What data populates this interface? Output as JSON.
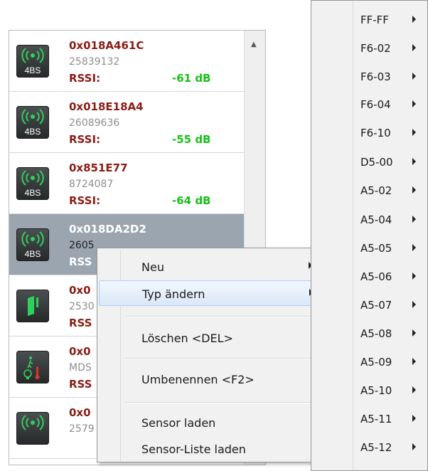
{
  "devices": [
    {
      "id": "0x018A461C",
      "number": "25839132",
      "rssi_label": "RSSI:",
      "rssi_value": "-61 dB",
      "icon": "radio-waves-icon",
      "icon_label": "4BS"
    },
    {
      "id": "0x018E18A4",
      "number": "26089636",
      "rssi_label": "RSSI:",
      "rssi_value": "-55 dB",
      "icon": "radio-waves-icon",
      "icon_label": "4BS"
    },
    {
      "id": "0x851E77",
      "number": "8724087",
      "rssi_label": "RSSI:",
      "rssi_value": "-64 dB",
      "icon": "radio-waves-icon",
      "icon_label": "4BS"
    },
    {
      "id": "0x018DA2D2",
      "number": "2605",
      "rssi_label": "RSS",
      "rssi_value": "",
      "icon": "radio-waves-icon",
      "icon_label": "4BS",
      "selected": true
    },
    {
      "id": "0x0",
      "number": "2530",
      "rssi_label": "RSS",
      "rssi_value": "",
      "icon": "window-contact-icon",
      "icon_label": ""
    },
    {
      "id": "0x0",
      "number": "MDS",
      "rssi_label": "RSS",
      "rssi_value": "",
      "icon": "motion-light-temp-icon",
      "icon_label": ""
    },
    {
      "id": "0x0",
      "number": "2579",
      "rssi_label": "",
      "rssi_value": "",
      "icon": "radio-waves-icon",
      "icon_label": ""
    }
  ],
  "context_menu": {
    "items": [
      {
        "label": "Neu",
        "submenu": true
      },
      {
        "label": "Typ ändern",
        "submenu": true,
        "highlighted": true
      },
      {
        "label": "Löschen <DEL>"
      },
      {
        "label": "Umbenennen <F2>"
      },
      {
        "label": "Sensor laden"
      },
      {
        "label": "Sensor-Liste laden"
      }
    ]
  },
  "type_submenu": {
    "items": [
      "FF-FF",
      "F6-02",
      "F6-03",
      "F6-04",
      "F6-10",
      "D5-00",
      "A5-02",
      "A5-04",
      "A5-05",
      "A5-06",
      "A5-07",
      "A5-08",
      "A5-09",
      "A5-10",
      "A5-11",
      "A5-12"
    ]
  },
  "colors": {
    "id_text": "#8b1b15",
    "rssi_value": "#18c018",
    "selected_row": "#9aa5b0",
    "menu_bg": "#f1f1f1",
    "menu_highlight": "#dae8f8"
  }
}
